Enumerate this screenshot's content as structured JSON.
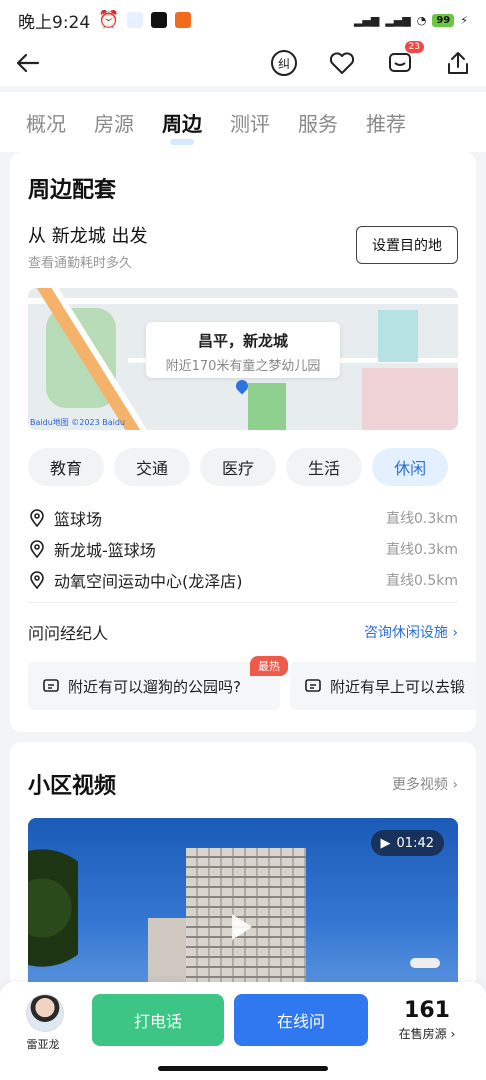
{
  "status": {
    "time": "晚上9:24",
    "battery": "99"
  },
  "nav": {
    "badge_count": "23"
  },
  "tabs": [
    "概况",
    "房源",
    "周边",
    "测评",
    "服务",
    "推荐"
  ],
  "active_tab": "周边",
  "surroundings": {
    "title": "周边配套",
    "from_text": "从 新龙城 出发",
    "from_sub": "查看通勤耗时多久",
    "dest_button": "设置目的地",
    "map_title": "昌平，新龙城",
    "map_sub": "附近170米有童之梦幼儿园",
    "map_credit": "Baidu地图 ©2023 Baidu",
    "categories": [
      "教育",
      "交通",
      "医疗",
      "生活",
      "休闲"
    ],
    "active_category": "休闲",
    "pois": [
      {
        "name": "篮球场",
        "distance": "直线0.3km"
      },
      {
        "name": "新龙城-篮球场",
        "distance": "直线0.3km"
      },
      {
        "name": "动氧空间运动中心(龙泽店)",
        "distance": "直线0.5km"
      }
    ],
    "ask_title": "问问经纪人",
    "ask_link": "咨询休闲设施",
    "questions": [
      "附近有可以遛狗的公园吗?",
      "附近有早上可以去锻"
    ],
    "hot_label": "最热"
  },
  "video": {
    "title": "小区视频",
    "more": "更多视频",
    "duration": "01:42"
  },
  "bottom": {
    "agent_name": "雷亚龙",
    "call": "打电话",
    "online": "在线问",
    "count": "161",
    "count_label": "在售房源"
  },
  "colors": {
    "primary": "#2f78f0",
    "call_green": "#3cc584",
    "link_blue": "#2b6fd8",
    "hot_red": "#ef5a4a"
  }
}
